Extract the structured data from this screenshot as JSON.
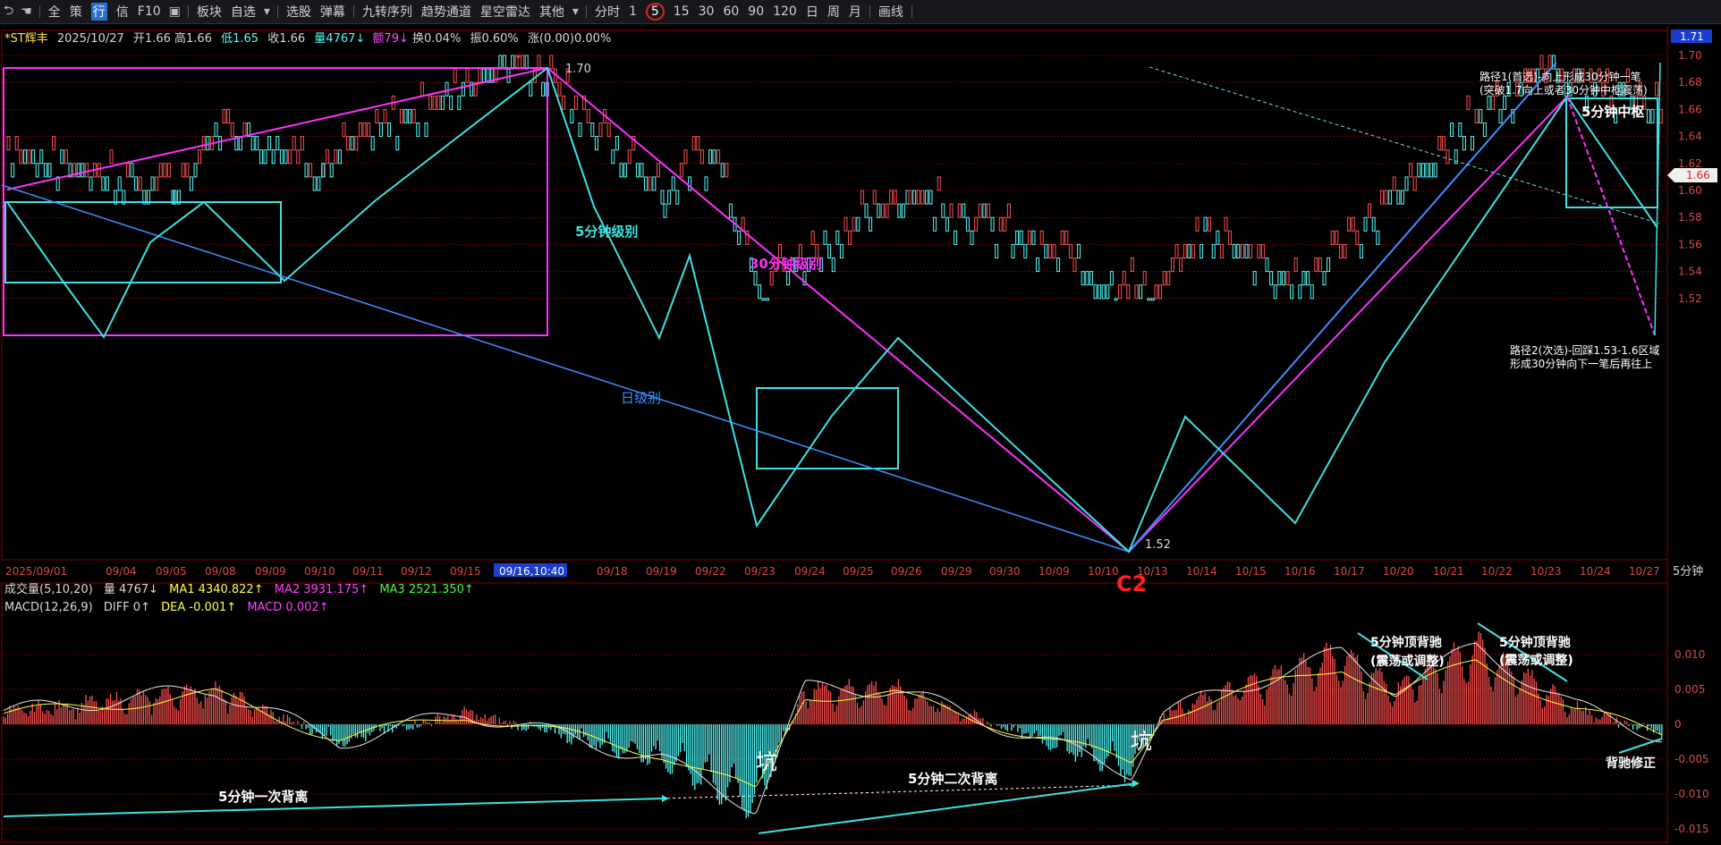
{
  "toolbar": {
    "items": [
      "全",
      "策",
      "行",
      "信",
      "F10",
      "板块",
      "自选",
      "选股",
      "弹幕",
      "九转序列",
      "趋势通道",
      "星空雷达",
      "其他",
      "分时",
      "1",
      "5",
      "15",
      "30",
      "60",
      "90",
      "120",
      "日",
      "周",
      "月",
      "画线"
    ]
  },
  "info": {
    "symbol": "*ST辉丰",
    "date": "2025/10/27",
    "open": "开1.66",
    "high": "高1.66",
    "low": "低1.65",
    "close": "收1.66",
    "volume": "量4767↓",
    "amount": "额79↓",
    "turnover": "换0.04%",
    "amplitude": "振0.60%",
    "change": "涨(0.00)0.00%"
  },
  "volume_line": {
    "label": "成交量(5,10,20)",
    "vol": "量 4767↓",
    "ma1": "MA1 4340.822↑",
    "ma2": "MA2 3931.175↑",
    "ma3": "MA3 2521.350↑"
  },
  "macd_line": {
    "label": "MACD(12,26,9)",
    "diff": "DIFF 0↑",
    "dea": "DEA -0.001↑",
    "macd": "MACD 0.002↑"
  },
  "period_label": "5分钟",
  "price_tag": "1.66",
  "top_price_tag": "1.71",
  "colors": {
    "up": "#ff5050",
    "down": "#54fcfc",
    "cyan_line": "#3fe0e0",
    "magenta": "#ff30ff",
    "blue": "#3f8fff",
    "grid": "#7a0000"
  },
  "annotations": {
    "p170": "1.70",
    "p152": "1.52",
    "c2": "C2",
    "lvl5": "5分钟级别",
    "lvl30": "30分钟级别",
    "lvlday": "日级别",
    "path1_a": "路径1(首选)-向上形成30分钟一笔",
    "path1_b": "(突破1.7向上或者30分钟中枢震荡)",
    "pivot5": "5分钟中枢",
    "path2_a": "路径2(次选)-回踩1.53-1.6区域",
    "path2_b": "形成30分钟向下一笔后再往上",
    "div1": "5分钟一次背离",
    "div2": "5分钟二次背离",
    "pit1": "坑",
    "pit2": "坑",
    "topdiv1_a": "5分钟顶背驰",
    "topdiv1_b": "(震荡或调整)",
    "topdiv2_a": "5分钟顶背驰",
    "topdiv2_b": "(震荡或调整)",
    "fix": "背驰修正"
  },
  "chart_data": [
    {
      "type": "candlestick",
      "title": "*ST辉丰 5分钟",
      "period": "5分钟",
      "x_dates": [
        "2025/09/01",
        "09/04",
        "09/05",
        "09/08",
        "09/09",
        "09/10",
        "09/11",
        "09/12",
        "09/15",
        "09/16,10:40",
        "09/18",
        "09/19",
        "09/22",
        "09/23",
        "09/24",
        "09/25",
        "09/26",
        "09/29",
        "09/30",
        "10/09",
        "10/10",
        "10/13",
        "10/14",
        "10/15",
        "10/16",
        "10/17",
        "10/20",
        "10/21",
        "10/22",
        "10/23",
        "10/24",
        "10/27"
      ],
      "y_ticks": [
        "1.70",
        "1.68",
        "1.66",
        "1.64",
        "1.62",
        "1.60",
        "1.58",
        "1.56",
        "1.54",
        "1.52"
      ],
      "ylim": [
        1.515,
        1.715
      ],
      "key_points": [
        {
          "date": "2025/09/01",
          "price": 1.63
        },
        {
          "date": "09/05",
          "price": 1.6
        },
        {
          "date": "09/08",
          "price": 1.65
        },
        {
          "date": "09/10",
          "price": 1.62
        },
        {
          "date": "09/16",
          "price": 1.7
        },
        {
          "date": "09/19",
          "price": 1.6
        },
        {
          "date": "09/22",
          "price": 1.63
        },
        {
          "date": "09/23",
          "price": 1.53
        },
        {
          "date": "09/26",
          "price": 1.6
        },
        {
          "date": "10/13",
          "price": 1.52
        },
        {
          "date": "10/14",
          "price": 1.57
        },
        {
          "date": "10/16",
          "price": 1.53
        },
        {
          "date": "10/22",
          "price": 1.67
        },
        {
          "date": "10/23",
          "price": 1.69
        },
        {
          "date": "10/27",
          "price": 1.66
        }
      ],
      "last_close": 1.66,
      "high": 1.7,
      "low": 1.52
    },
    {
      "type": "bar",
      "title": "MACD(12,26,9)",
      "y_ticks": [
        "0.010",
        "0.005",
        "0",
        "-0.005",
        "-0.010",
        "-0.015"
      ],
      "ylim": [
        -0.016,
        0.014
      ],
      "last_values": {
        "DIFF": 0,
        "DEA": -0.001,
        "MACD": 0.002
      }
    }
  ]
}
